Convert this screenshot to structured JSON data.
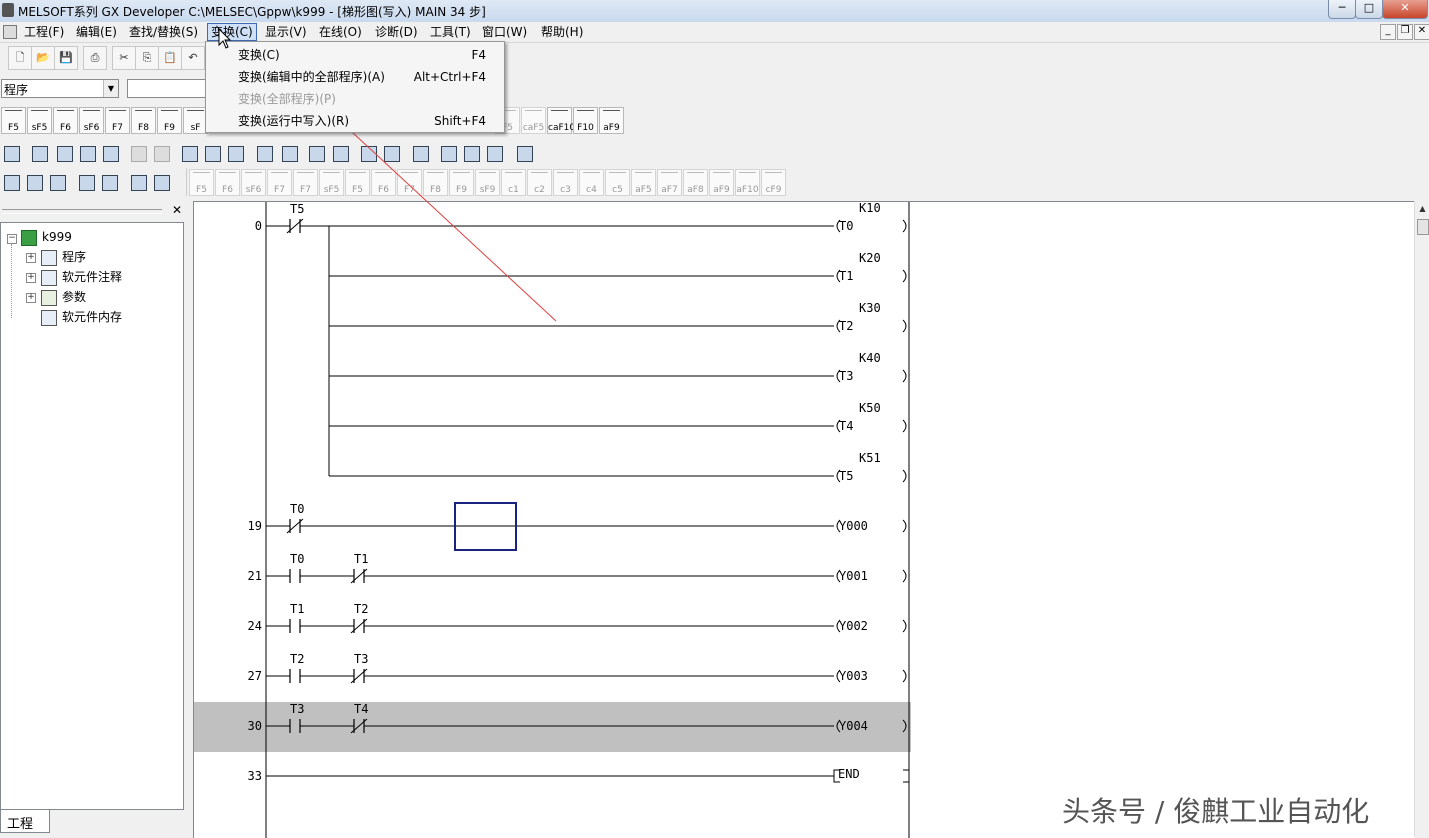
{
  "window": {
    "title": "MELSOFT系列 GX Developer C:\\MELSEC\\Gppw\\k999 - [梯形图(写入)     MAIN     34 步]",
    "min": "─",
    "max": "□",
    "close": "✕"
  },
  "menu": {
    "items": [
      "工程(F)",
      "编辑(E)",
      "查找/替换(S)",
      "变换(C)",
      "显示(V)",
      "在线(O)",
      "诊断(D)",
      "工具(T)",
      "窗口(W)",
      "帮助(H)"
    ],
    "active_index": 3,
    "mdi_min": "_",
    "mdi_restore": "❐",
    "mdi_close": "✕"
  },
  "dropdown": {
    "items": [
      {
        "label": "变换(C)",
        "key": "F4",
        "enabled": true
      },
      {
        "label": "变换(编辑中的全部程序)(A)",
        "key": "Alt+Ctrl+F4",
        "enabled": true
      },
      {
        "label": "变换(全部程序)(P)",
        "key": "",
        "enabled": false
      },
      {
        "label": "变换(运行中写入)(R)",
        "key": "Shift+F4",
        "enabled": true
      }
    ]
  },
  "toolbar": {
    "combo_value": "程序",
    "ladder_keys": [
      "F5",
      "sF5",
      "F6",
      "sF6",
      "F7",
      "F8",
      "F9",
      "sF"
    ],
    "ladder_keys_right": [
      "F5",
      "caF5",
      "caF10",
      "F10",
      "aF9"
    ],
    "symbol_keys": [
      "F5",
      "F6",
      "sF6",
      "F7",
      "F7",
      "sF5",
      "F5",
      "F6",
      "F7",
      "F8",
      "F9",
      "sF9",
      "c1",
      "c2",
      "c3",
      "c4",
      "c5",
      "aF5",
      "aF7",
      "aF8",
      "aF9",
      "aF10",
      "cF9"
    ]
  },
  "tree": {
    "root": "k999",
    "items": [
      "程序",
      "软元件注释",
      "参数",
      "软元件内存"
    ],
    "tab": "工程"
  },
  "ladder": {
    "rungs": [
      {
        "step": "0",
        "contacts": [
          {
            "label": "T5",
            "type": "nc"
          }
        ],
        "coils": [
          {
            "name": "T0",
            "k": "K10"
          },
          {
            "name": "T1",
            "k": "K20"
          },
          {
            "name": "T2",
            "k": "K30"
          },
          {
            "name": "T3",
            "k": "K40"
          },
          {
            "name": "T4",
            "k": "K50"
          },
          {
            "name": "T5",
            "k": "K51"
          }
        ]
      },
      {
        "step": "19",
        "contacts": [
          {
            "label": "T0",
            "type": "nc"
          }
        ],
        "coils": [
          {
            "name": "Y000"
          }
        ]
      },
      {
        "step": "21",
        "contacts": [
          {
            "label": "T0",
            "type": "no"
          },
          {
            "label": "T1",
            "type": "nc"
          }
        ],
        "coils": [
          {
            "name": "Y001"
          }
        ]
      },
      {
        "step": "24",
        "contacts": [
          {
            "label": "T1",
            "type": "no"
          },
          {
            "label": "T2",
            "type": "nc"
          }
        ],
        "coils": [
          {
            "name": "Y002"
          }
        ]
      },
      {
        "step": "27",
        "contacts": [
          {
            "label": "T2",
            "type": "no"
          },
          {
            "label": "T3",
            "type": "nc"
          }
        ],
        "coils": [
          {
            "name": "Y003"
          }
        ]
      },
      {
        "step": "30",
        "contacts": [
          {
            "label": "T3",
            "type": "no"
          },
          {
            "label": "T4",
            "type": "nc"
          }
        ],
        "coils": [
          {
            "name": "Y004"
          }
        ],
        "highlighted": true
      },
      {
        "step": "33",
        "contacts": [],
        "coils": [
          {
            "name": "END"
          }
        ]
      }
    ]
  },
  "watermark": "头条号 / 俊麒工业自动化",
  "colors": {
    "highlight_row": "#c0c0c0",
    "cursor_box": "#1a237e",
    "annotation": "#e04040",
    "menu_active": "#cfe0f7"
  }
}
